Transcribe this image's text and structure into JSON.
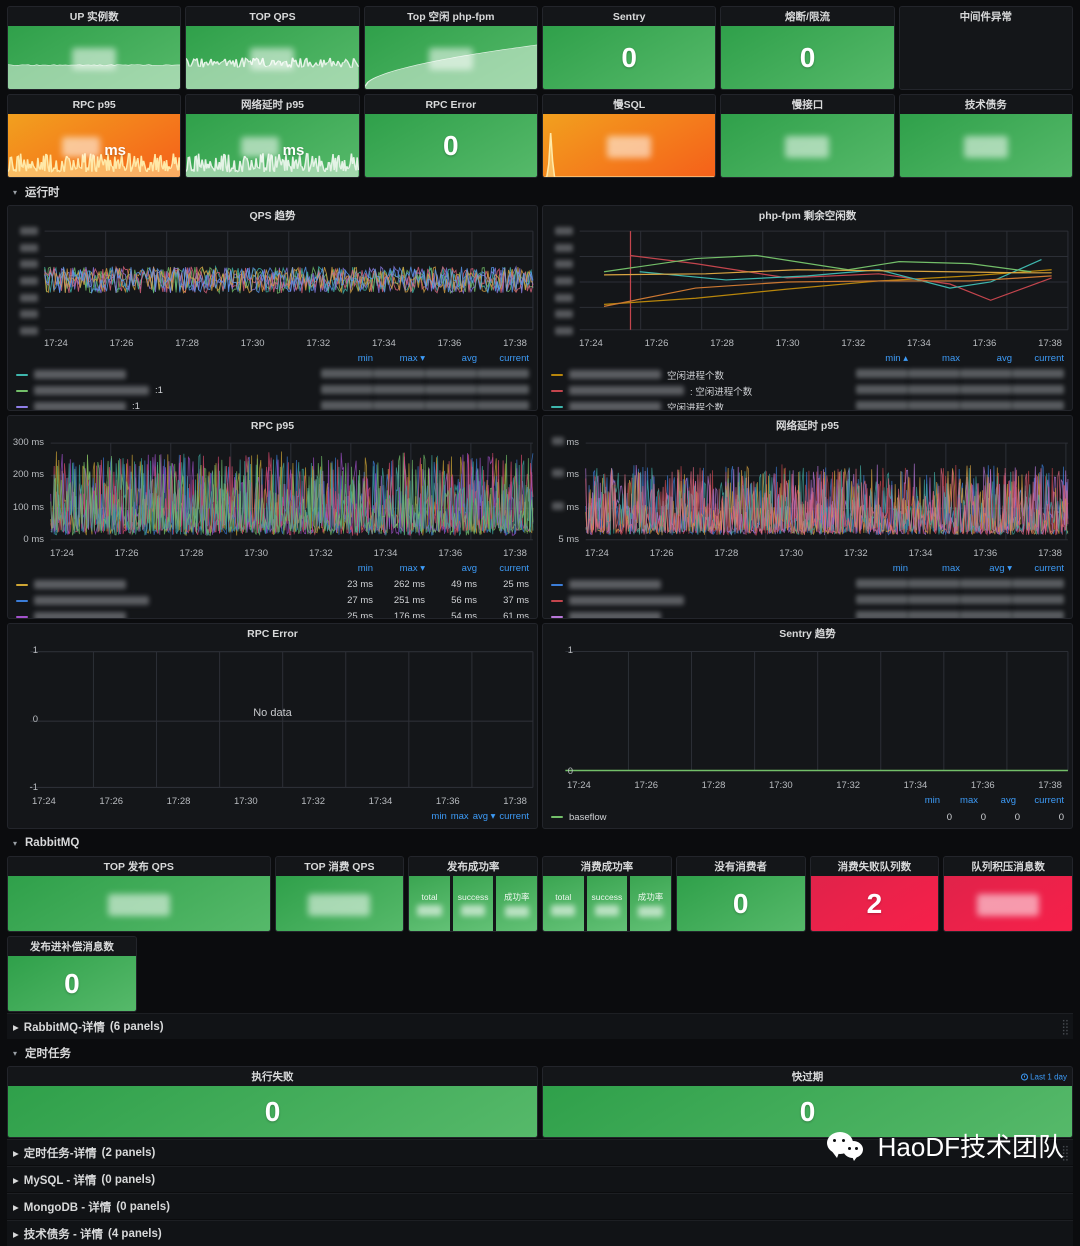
{
  "top_stats": [
    {
      "title": "UP 实例数",
      "value": "",
      "display": "blurred",
      "style": "green",
      "spark": "area-flat"
    },
    {
      "title": "TOP QPS",
      "value": "",
      "display": "blurred",
      "style": "green",
      "spark": "noise-mid"
    },
    {
      "title": "Top 空闲 php-fpm",
      "value": "",
      "display": "blurred",
      "style": "green",
      "spark": "curve-rise"
    },
    {
      "title": "Sentry",
      "value": "0",
      "display": "text",
      "style": "green",
      "spark": "none"
    },
    {
      "title": "熔断/限流",
      "value": "0",
      "display": "text",
      "style": "green",
      "spark": "none"
    },
    {
      "title": "中间件异常",
      "value": "",
      "display": "none",
      "style": "empty",
      "spark": "none"
    },
    {
      "title": "RPC p95",
      "value": "",
      "unit": "ms",
      "display": "blurred-unit",
      "style": "orange",
      "spark": "noise-low"
    },
    {
      "title": "网络延时 p95",
      "value": "",
      "unit": "ms",
      "display": "blurred-unit",
      "style": "green",
      "spark": "noise-low"
    },
    {
      "title": "RPC Error",
      "value": "0",
      "display": "text",
      "style": "green",
      "spark": "none"
    },
    {
      "title": "慢SQL",
      "value": "",
      "display": "blurred",
      "style": "orange",
      "spark": "spike-left"
    },
    {
      "title": "慢接口",
      "value": "",
      "display": "blurred",
      "style": "green",
      "spark": "none"
    },
    {
      "title": "技术债务",
      "value": "",
      "display": "blurred",
      "style": "green",
      "spark": "none"
    }
  ],
  "rows": {
    "runtime": {
      "label": "运行时",
      "expanded": true
    },
    "rabbitmq": {
      "label": "RabbitMQ",
      "expanded": true
    },
    "rabbitmq_detail": {
      "label": "RabbitMQ-详情",
      "count": "(6 panels)",
      "expanded": false
    },
    "cron": {
      "label": "定时任务",
      "expanded": true
    },
    "cron_detail": {
      "label": "定时任务-详情",
      "count": "(2 panels)",
      "expanded": false
    },
    "mysql_detail": {
      "label": "MySQL - 详情",
      "count": "(0 panels)",
      "expanded": false
    },
    "mongo_detail": {
      "label": "MongoDB - 详情",
      "count": "(0 panels)",
      "expanded": false
    },
    "debt_detail": {
      "label": "技术债务 - 详情",
      "count": "(4 panels)",
      "expanded": false
    }
  },
  "legend_cols": {
    "min": "min",
    "max": "max",
    "avg": "avg",
    "current": "current"
  },
  "chart_data": [
    {
      "id": "qps",
      "type": "line",
      "title": "QPS 趋势",
      "xlabel": "",
      "ylabel": "",
      "xticks": [
        "17:24",
        "17:26",
        "17:28",
        "17:30",
        "17:32",
        "17:34",
        "17:36",
        "17:38"
      ],
      "yticks": [
        "",
        "",
        "",
        "",
        "",
        "",
        ""
      ],
      "yticks_redacted": true,
      "grid": true,
      "legend_position": "bottom",
      "sort_col": "max",
      "sort_dir": "desc",
      "series": [
        {
          "name": "",
          "redacted": true,
          "suffix": "",
          "color": "#3eb6ad",
          "min": "",
          "max": "",
          "avg": "",
          "current": ""
        },
        {
          "name": "",
          "redacted": true,
          "suffix": ":1",
          "color": "#73bf69",
          "min": "",
          "max": "",
          "avg": "",
          "current": ""
        },
        {
          "name": "",
          "redacted": true,
          "suffix": ":1",
          "color": "#8f7ee8",
          "min": "",
          "max": "",
          "avg": "",
          "current": ""
        }
      ]
    },
    {
      "id": "phpfpm",
      "type": "line",
      "title": "php-fpm 剩余空闲数",
      "xticks": [
        "17:24",
        "17:26",
        "17:28",
        "17:30",
        "17:32",
        "17:34",
        "17:36",
        "17:38"
      ],
      "yticks_redacted": true,
      "grid": true,
      "sort_col": "min",
      "sort_dir": "asc",
      "series": [
        {
          "name": "空闲进程个数",
          "redacted": true,
          "color": "#b8860b",
          "min": "",
          "max": "",
          "avg": "",
          "current": ""
        },
        {
          "name": ": 空闲进程个数",
          "redacted": true,
          "color": "#c4454d",
          "min": "",
          "max": "",
          "avg": "",
          "current": ""
        },
        {
          "name": "空闲进程个数",
          "redacted": true,
          "color": "#3eb6ad",
          "min": "",
          "max": "",
          "avg": "",
          "current": ""
        }
      ]
    },
    {
      "id": "rpc_p95",
      "type": "line",
      "title": "RPC p95",
      "xticks": [
        "17:24",
        "17:26",
        "17:28",
        "17:30",
        "17:32",
        "17:34",
        "17:36",
        "17:38"
      ],
      "yticks": [
        "300 ms",
        "200 ms",
        "100 ms",
        "0 ms"
      ],
      "ylim": [
        0,
        300
      ],
      "grid": true,
      "sort_col": "max",
      "sort_dir": "desc",
      "series": [
        {
          "name": "",
          "redacted": true,
          "color": "#cfa634",
          "min": "23 ms",
          "max": "262 ms",
          "avg": "49 ms",
          "current": "25 ms"
        },
        {
          "name": "",
          "redacted": true,
          "color": "#3b7dd8",
          "min": "27 ms",
          "max": "251 ms",
          "avg": "56 ms",
          "current": "37 ms"
        },
        {
          "name": "",
          "redacted": true,
          "color": "#a352cc",
          "min": "25 ms",
          "max": "176 ms",
          "avg": "54 ms",
          "current": "61 ms"
        }
      ]
    },
    {
      "id": "net_p95",
      "type": "line",
      "title": "网络延时 p95",
      "xticks": [
        "17:24",
        "17:26",
        "17:28",
        "17:30",
        "17:32",
        "17:34",
        "17:36",
        "17:38"
      ],
      "yticks": [
        "ms",
        "ms",
        "ms",
        "5 ms"
      ],
      "yticks_redacted": true,
      "grid": true,
      "sort_col": "avg",
      "sort_dir": "desc",
      "series": [
        {
          "name": "",
          "redacted": true,
          "color": "#3b7dd8",
          "min": "",
          "max": "",
          "avg": "",
          "current": ""
        },
        {
          "name": "",
          "redacted": true,
          "color": "#c4454d",
          "min": "",
          "max": "",
          "avg": "",
          "current": ""
        },
        {
          "name": "",
          "redacted": true,
          "color": "#b877d9",
          "min": "",
          "max": "",
          "avg": "",
          "current": ""
        }
      ]
    },
    {
      "id": "rpc_error",
      "type": "line",
      "title": "RPC Error",
      "xticks": [
        "17:24",
        "17:26",
        "17:28",
        "17:30",
        "17:32",
        "17:34",
        "17:36",
        "17:38"
      ],
      "yticks": [
        "1",
        "0",
        "-1"
      ],
      "ylim": [
        -1,
        1
      ],
      "grid": true,
      "empty_message": "No data",
      "sort_col": "avg",
      "sort_dir": "desc",
      "series": []
    },
    {
      "id": "sentry_trend",
      "type": "line",
      "title": "Sentry 趋势",
      "xticks": [
        "17:24",
        "17:26",
        "17:28",
        "17:30",
        "17:32",
        "17:34",
        "17:36",
        "17:38"
      ],
      "yticks": [
        "1",
        "0"
      ],
      "ylim": [
        0,
        1
      ],
      "grid": true,
      "sort_col": "",
      "series": [
        {
          "name": "baseflow",
          "redacted": false,
          "color": "#73bf69",
          "min": "0",
          "max": "0",
          "avg": "0",
          "current": "0"
        }
      ]
    }
  ],
  "rabbitmq_stats": [
    {
      "title": "TOP 发布 QPS",
      "value": "",
      "display": "blurred",
      "style": "green"
    },
    {
      "title": "TOP 消费 QPS",
      "value": "",
      "display": "blurred",
      "style": "green"
    },
    {
      "title": "发布成功率",
      "display": "substat",
      "style": "green",
      "cells": [
        {
          "label": "total",
          "value": ""
        },
        {
          "label": "success",
          "value": ""
        },
        {
          "label": "成功率",
          "value": ""
        }
      ]
    },
    {
      "title": "消费成功率",
      "display": "substat",
      "style": "green",
      "cells": [
        {
          "label": "total",
          "value": ""
        },
        {
          "label": "success",
          "value": ""
        },
        {
          "label": "成功率",
          "value": ""
        }
      ]
    },
    {
      "title": "没有消费者",
      "value": "0",
      "display": "text",
      "style": "green"
    },
    {
      "title": "消费失败队列数",
      "value": "2",
      "display": "text",
      "style": "red"
    },
    {
      "title": "队列积压消息数",
      "value": "",
      "display": "blurred",
      "style": "red"
    },
    {
      "title": "发布进补偿消息数",
      "value": "0",
      "display": "text",
      "style": "green"
    }
  ],
  "cron_stats": [
    {
      "title": "执行失败",
      "value": "0",
      "style": "green",
      "badge": ""
    },
    {
      "title": "快过期",
      "value": "0",
      "style": "green",
      "badge": "Last 1 day"
    }
  ],
  "watermark": {
    "text": "HaoDF技术团队",
    "icon": "wechat-icon"
  }
}
